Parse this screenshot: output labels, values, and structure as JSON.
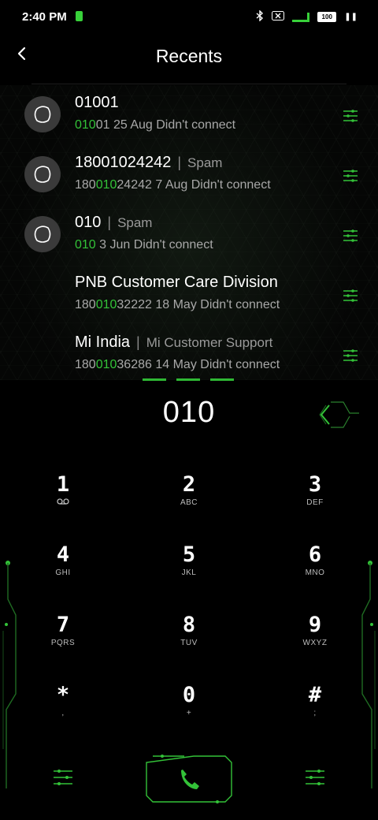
{
  "status": {
    "time": "2:40 PM",
    "battery": "100"
  },
  "header": {
    "title": "Recents",
    "back_icon": "back-arrow-icon"
  },
  "recents": [
    {
      "name": "01001",
      "tag": "",
      "number_pre": "",
      "number_match": "010",
      "number_post": "01",
      "date": "25 Aug",
      "status": "Didn't connect",
      "has_avatar": true
    },
    {
      "name": "18001024242",
      "tag": "Spam",
      "number_pre": "180",
      "number_match": "010",
      "number_post": "24242",
      "date": "7 Aug",
      "status": "Didn't connect",
      "has_avatar": true
    },
    {
      "name": "010",
      "tag": "Spam",
      "number_pre": "",
      "number_match": "010",
      "number_post": "",
      "date": "3 Jun",
      "status": "Didn't connect",
      "has_avatar": true
    },
    {
      "name": "PNB Customer Care Division",
      "tag": "",
      "number_pre": "180",
      "number_match": "010",
      "number_post": "32222",
      "date": "18 May",
      "status": "Didn't connect",
      "has_avatar": false
    },
    {
      "name": "Mi India",
      "tag": "Mi Customer Support",
      "number_pre": "180",
      "number_match": "010",
      "number_post": "36286",
      "date": "14 May",
      "status": "Didn't connect",
      "has_avatar": false
    }
  ],
  "dialer": {
    "typed_number": "010",
    "keys": [
      {
        "digit": "1",
        "letters": "voicemail-icon"
      },
      {
        "digit": "2",
        "letters": "ABC"
      },
      {
        "digit": "3",
        "letters": "DEF"
      },
      {
        "digit": "4",
        "letters": "GHI"
      },
      {
        "digit": "5",
        "letters": "JKL"
      },
      {
        "digit": "6",
        "letters": "MNO"
      },
      {
        "digit": "7",
        "letters": "PQRS"
      },
      {
        "digit": "8",
        "letters": "TUV"
      },
      {
        "digit": "9",
        "letters": "WXYZ"
      },
      {
        "digit": "*",
        "letters": ","
      },
      {
        "digit": "0",
        "letters": "+"
      },
      {
        "digit": "#",
        "letters": ";"
      }
    ]
  },
  "colors": {
    "accent": "#33c238",
    "background": "#000000",
    "avatar": "#3a3a3a",
    "secondary_text": "#a8a8a8"
  }
}
